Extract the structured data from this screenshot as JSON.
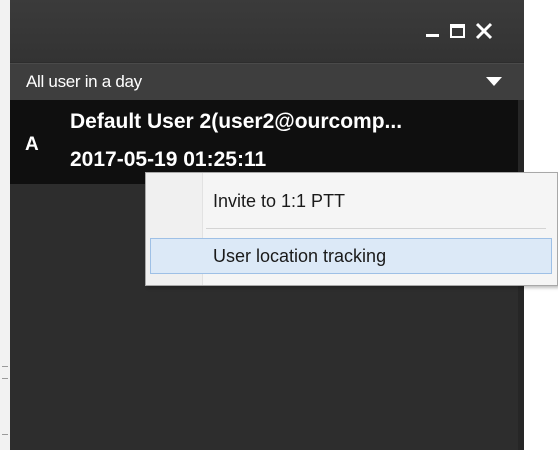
{
  "window": {
    "controls": {
      "minimize_icon": "minimize-icon",
      "maximize_icon": "maximize-icon",
      "close_icon": "close-icon"
    },
    "colors": {
      "titlebar": "#363636",
      "panel": "#2d2d2d",
      "selected_row": "#0f0f0f",
      "text": "#ffffff"
    }
  },
  "filter": {
    "selected": "All user in a day",
    "caret_icon": "caret-down-icon"
  },
  "user_list": [
    {
      "avatar": "A",
      "name": "Default User 2(user2@ourcomp...",
      "timestamp": "2017-05-19 01:25:11"
    }
  ],
  "context_menu": {
    "items": [
      {
        "label": "Invite to 1:1 PTT",
        "highlighted": false
      },
      {
        "label": "User location tracking",
        "highlighted": true
      }
    ],
    "highlight_color": "#dce9f7"
  }
}
